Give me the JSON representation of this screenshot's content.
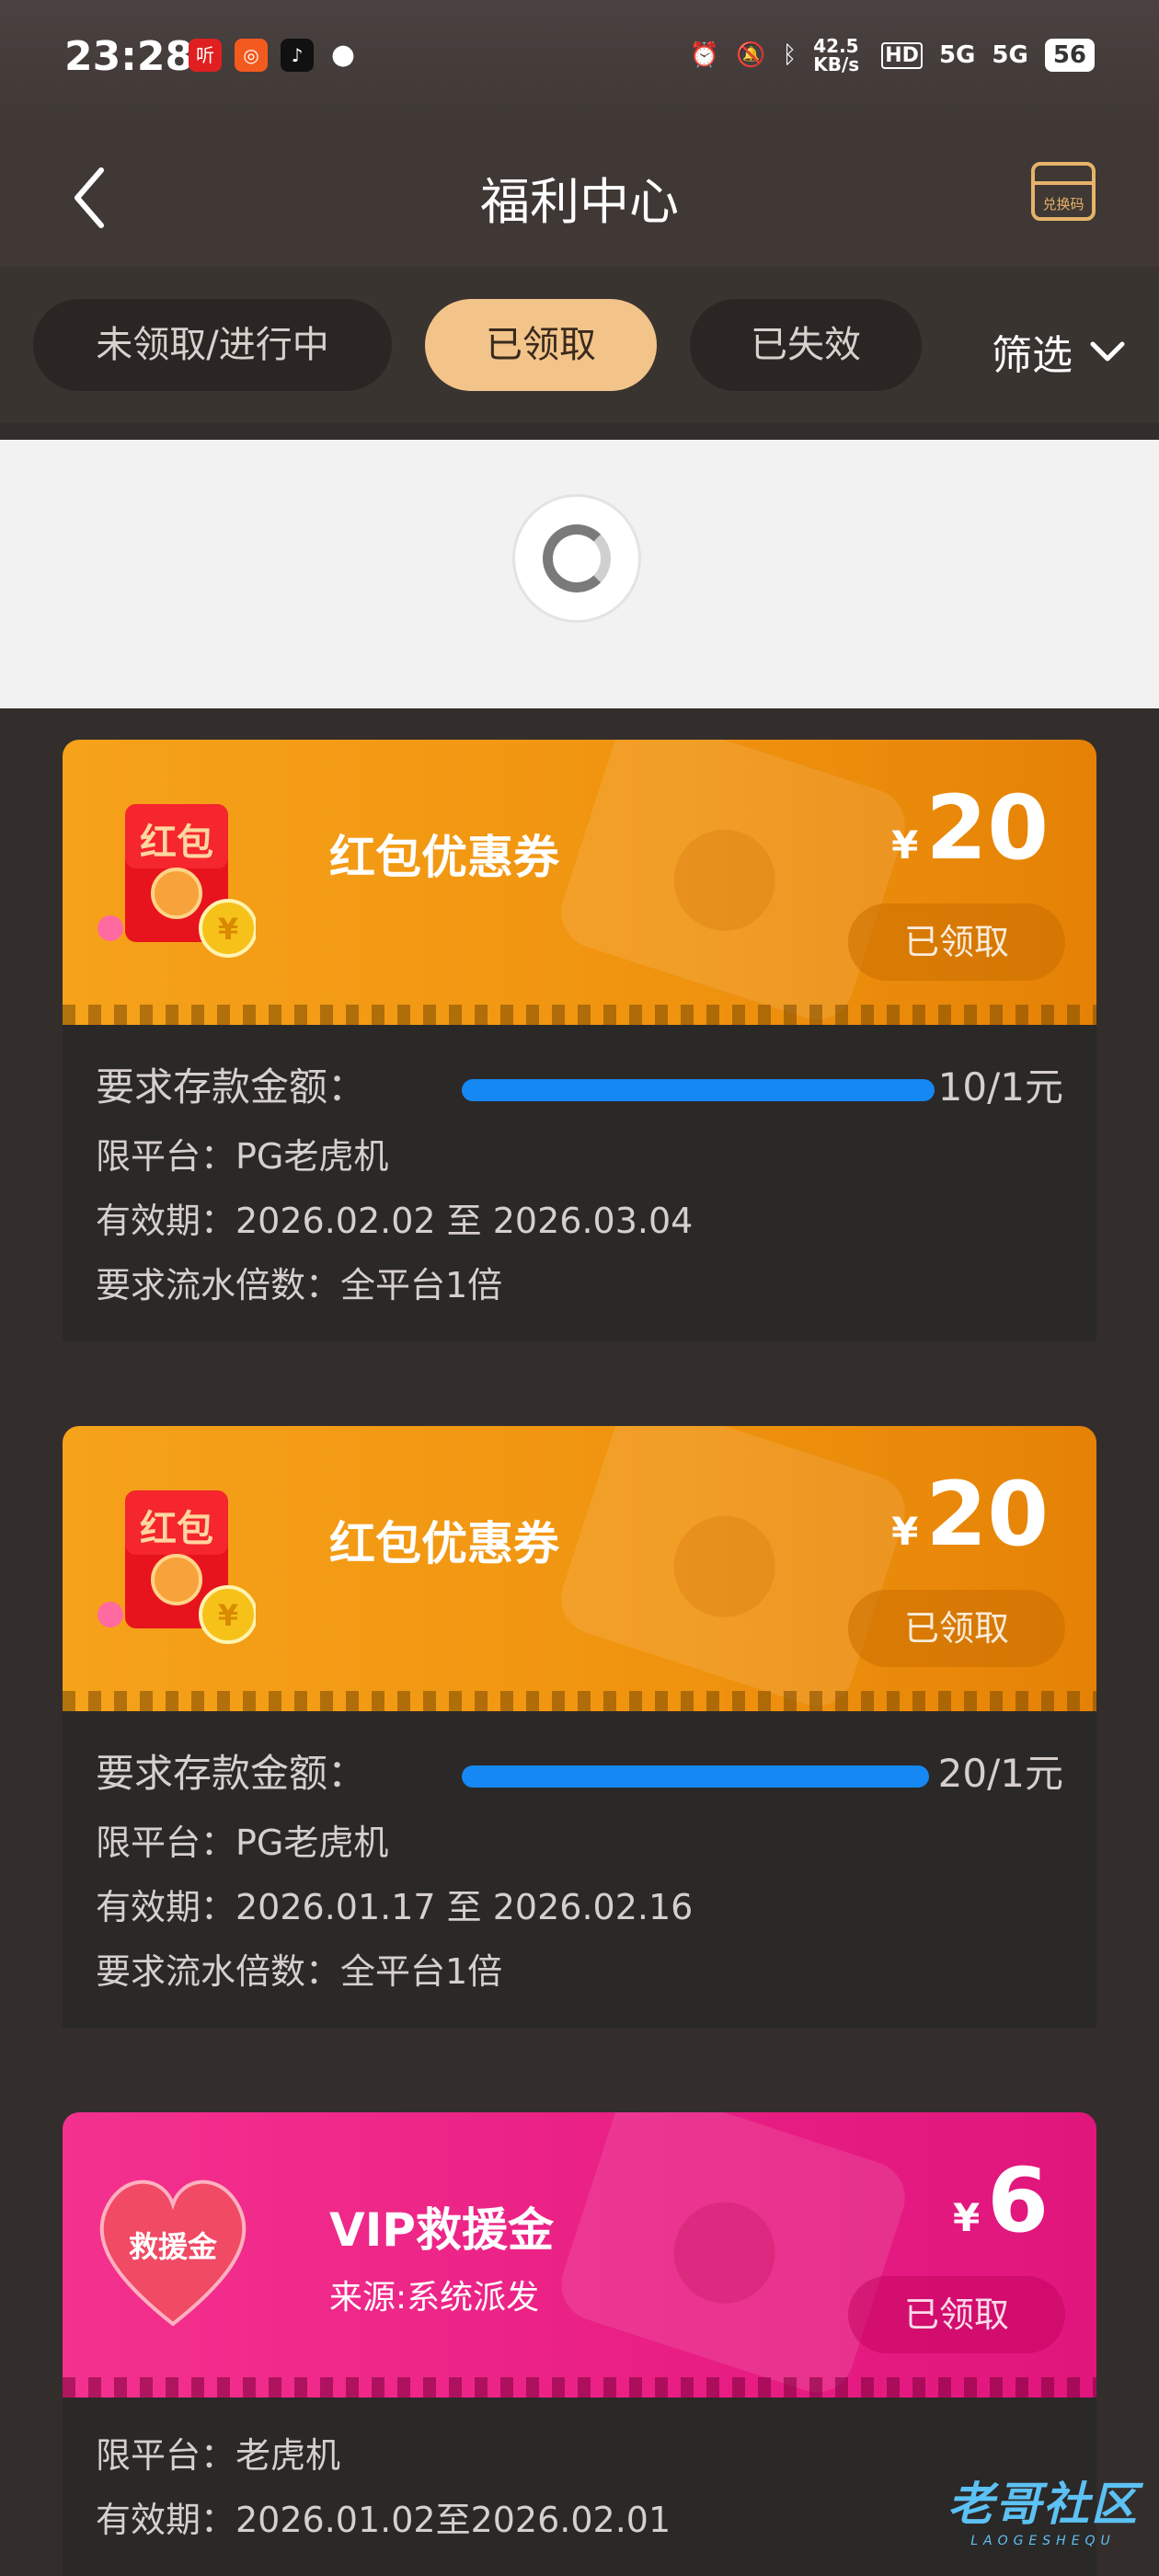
{
  "status_bar": {
    "time": "23:28",
    "speed": "42.5\nKB/s",
    "battery": "56",
    "signal_1": "5G",
    "signal_2": "5G",
    "hd": "HD"
  },
  "header": {
    "title": "福利中心",
    "redeem_label": "兑换码"
  },
  "tabs": [
    {
      "label": "未领取/进行中"
    },
    {
      "label": "已领取"
    },
    {
      "label": "已失效"
    }
  ],
  "filter": {
    "label": "筛选"
  },
  "cards": [
    {
      "title": "红包优惠券",
      "icon_label": "红包",
      "currency": "¥",
      "amount": "20",
      "status": "已领取",
      "deposit_label": "要求存款金额：",
      "deposit_progress": 1.0,
      "deposit_value": "10/1元",
      "platform": "限平台：PG老虎机",
      "validity": "有效期：2026.02.02 至 2026.03.04",
      "turnover": "要求流水倍数：全平台1倍"
    },
    {
      "title": "红包优惠券",
      "icon_label": "红包",
      "currency": "¥",
      "amount": "20",
      "status": "已领取",
      "deposit_label": "要求存款金额：",
      "deposit_progress": 1.0,
      "deposit_value": "20/1元",
      "platform": "限平台：PG老虎机",
      "validity": "有效期：2026.01.17 至 2026.02.16",
      "turnover": "要求流水倍数：全平台1倍"
    },
    {
      "title": "VIP救援金",
      "subtitle": "来源:系统派发",
      "icon_label": "救援金",
      "currency": "¥",
      "amount": "6",
      "status": "已领取",
      "platform": "限平台：老虎机",
      "validity": "有效期：2026.01.02至2026.02.01"
    }
  ],
  "watermark": {
    "text": "老哥社区",
    "sub": "LAOGESHEQU"
  }
}
